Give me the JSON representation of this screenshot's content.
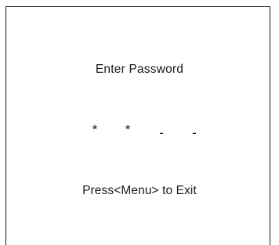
{
  "dialog": {
    "title": "Enter Password",
    "password_slots": [
      "*",
      "*",
      "-",
      "-"
    ],
    "exit_hint": "Press<Menu> to Exit"
  }
}
